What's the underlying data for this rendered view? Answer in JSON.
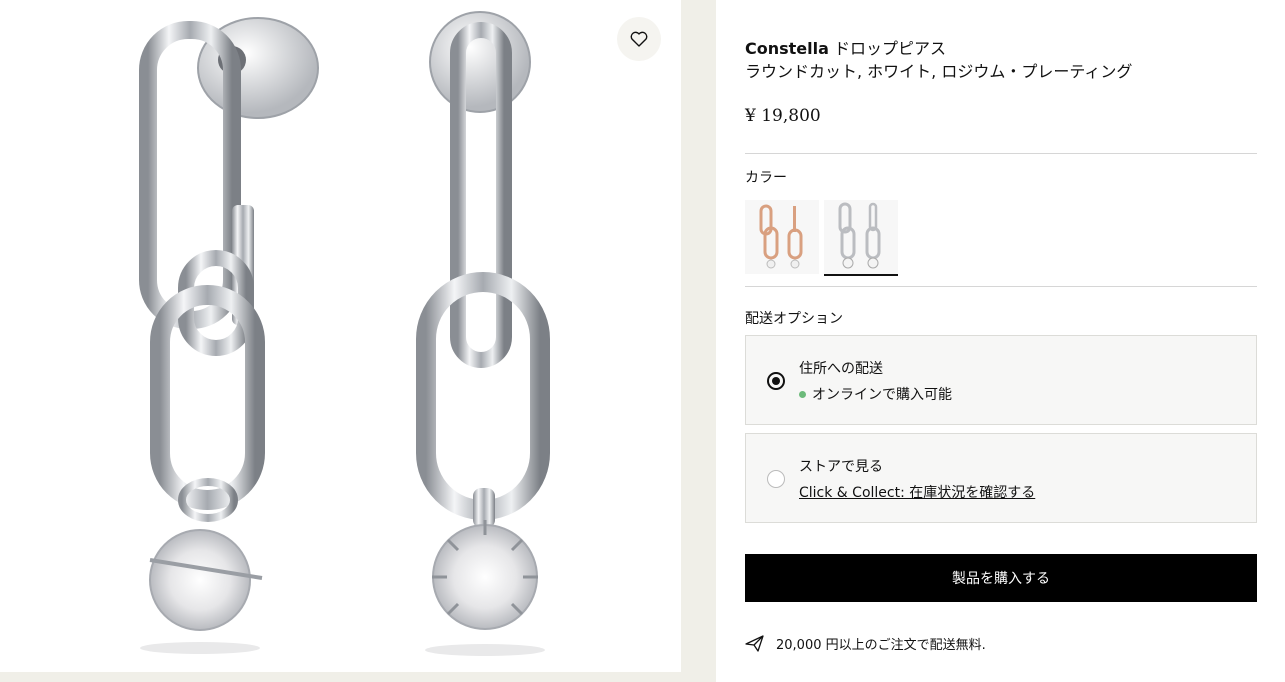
{
  "product": {
    "brand": "Constella",
    "title_suffix": "ドロップピアス",
    "subtitle": "ラウンドカット, ホワイト, ロジウム・プレーティング",
    "price": "¥ 19,800"
  },
  "gallery": {
    "wishlist_icon": "heart-icon",
    "image": "silver-chain-link-drop-earrings"
  },
  "color": {
    "label": "カラー",
    "swatches": [
      {
        "name": "rose-gold",
        "color": "#d9a080",
        "selected": false
      },
      {
        "name": "rhodium",
        "color": "#c8c8c8",
        "selected": true
      }
    ]
  },
  "delivery": {
    "label": "配送オプション",
    "options": [
      {
        "title": "住所への配送",
        "sub": "オンラインで購入可能",
        "selected": true,
        "status_color": "#6cba7a"
      },
      {
        "title": "ストアで見る",
        "link": "Click & Collect: 在庫状況を確認する",
        "selected": false
      }
    ]
  },
  "buy_button": "製品を購入する",
  "shipping_note": "20,000 円以上のご注文で配送無料."
}
